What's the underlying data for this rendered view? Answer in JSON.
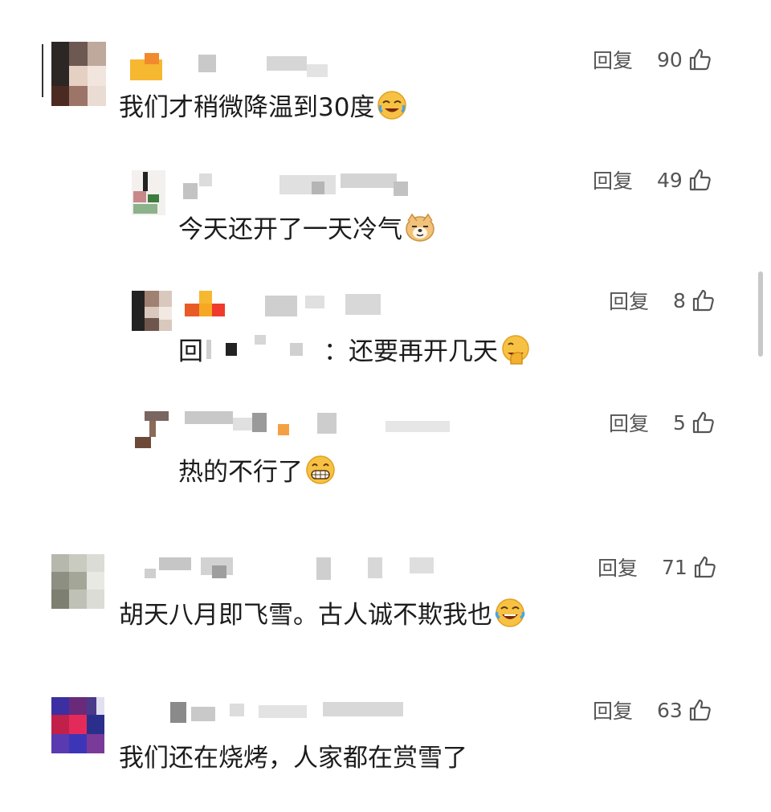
{
  "comments": [
    {
      "reply_label": "回复",
      "likes": "90",
      "text": "我们才稍微降温到30度",
      "emoji": "crying-laughing"
    },
    {
      "reply_label": "回复",
      "likes": "49",
      "text": "今天还开了一天冷气",
      "emoji": "doge"
    },
    {
      "reply_label": "回复",
      "likes": "8",
      "text_prefix": "回",
      "text": "：还要再开几天",
      "emoji": "facepalm"
    },
    {
      "reply_label": "回复",
      "likes": "5",
      "text": "热的不行了",
      "emoji": "grin"
    },
    {
      "reply_label": "回复",
      "likes": "71",
      "text": "胡天八月即飞雪。古人诚不欺我也",
      "emoji": "tears-of-joy"
    },
    {
      "reply_label": "回复",
      "likes": "63",
      "text": "我们还在烧烤，人家都在赏雪了",
      "emoji": ""
    }
  ],
  "colors": {
    "text": "#1c1c1c",
    "action": "#555555",
    "emoji_yellow": "#f7c244"
  }
}
